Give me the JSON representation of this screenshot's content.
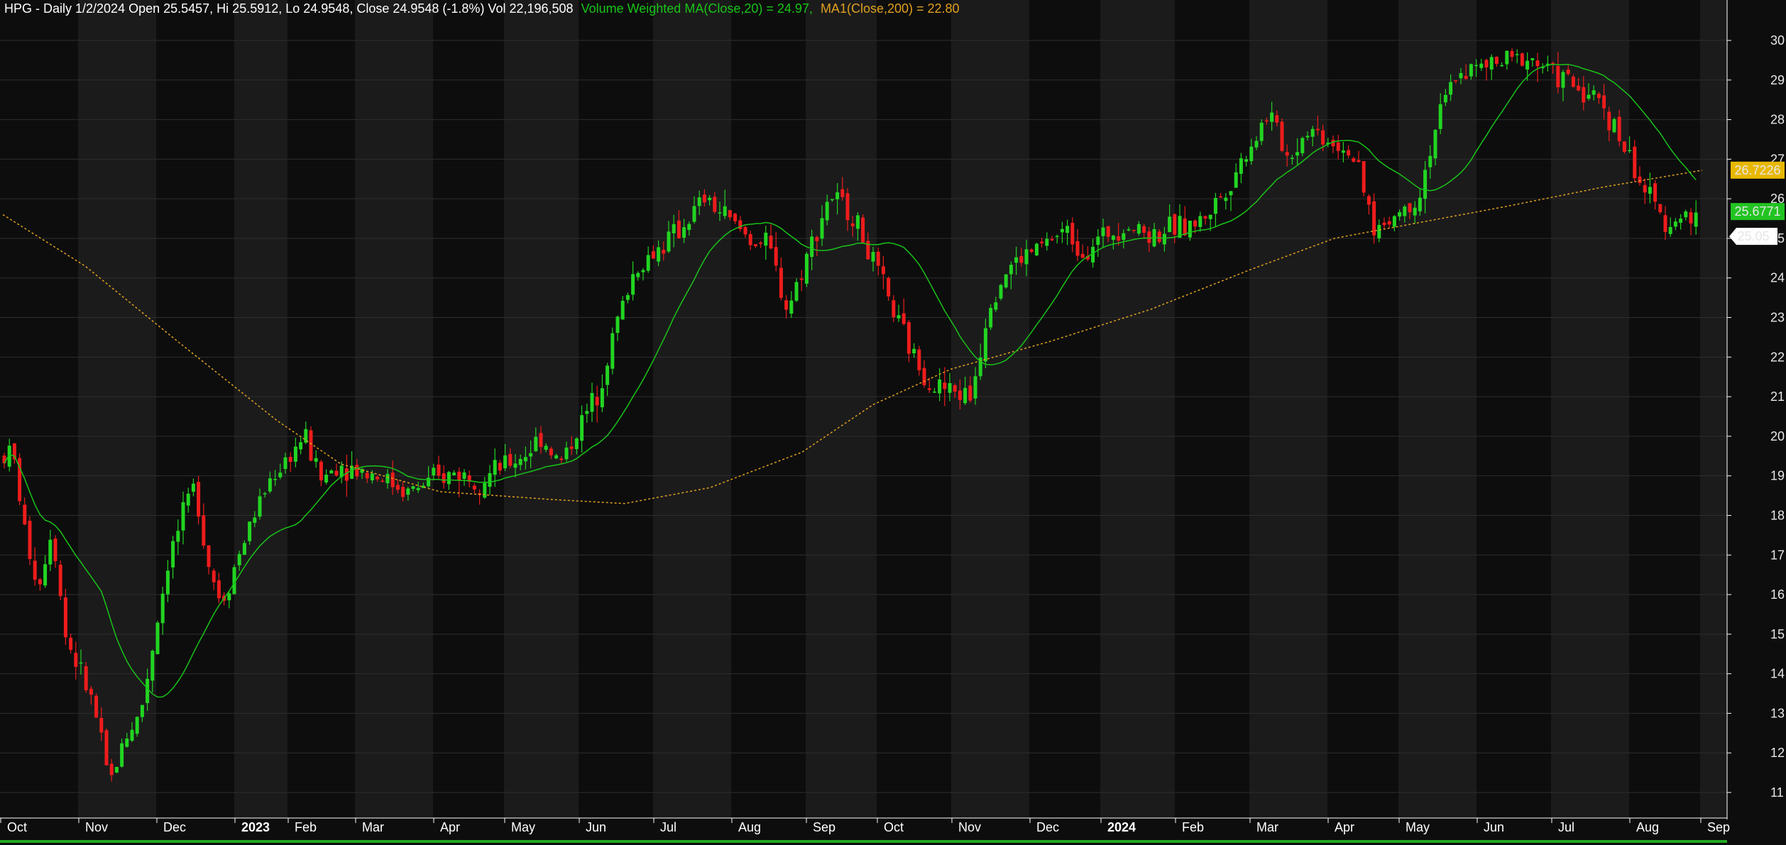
{
  "header": {
    "symbol_info": "HPG - Daily 1/2/2024 Open 25.5457, Hi 25.5912, Lo 24.9548, Close 24.9548 (-1.8%) Vol 22,196,508",
    "vwma_label": "Volume Weighted MA(Close,20) = 24.97,",
    "ma_label": "MA1(Close,200) = 22.80"
  },
  "colors": {
    "background": "#0d0d0d",
    "band_alt": "#1b1b1b",
    "grid": "#2e2e2e",
    "up": "#22d422",
    "down": "#ee1c1c",
    "vwma": "#19c419",
    "ma200": "#e0a020",
    "text": "#ffffff"
  },
  "chart_data": {
    "type": "candlestick",
    "title": "HPG - Daily",
    "x_labels": [
      "Oct",
      "Nov",
      "Dec",
      "2023",
      "Feb",
      "Mar",
      "Apr",
      "May",
      "Jun",
      "Jul",
      "Aug",
      "Sep",
      "Oct",
      "Nov",
      "Dec",
      "2024",
      "Feb",
      "Mar",
      "Apr",
      "May",
      "Jun",
      "Jul",
      "Aug",
      "Sep"
    ],
    "y_ticks": [
      11,
      12,
      13,
      14,
      15,
      16,
      17,
      18,
      19,
      20,
      21,
      22,
      23,
      24,
      25,
      26,
      27,
      28,
      29,
      30
    ],
    "ylim": [
      10.6,
      30.3
    ],
    "grid": true,
    "price_anchors": [
      [
        "Oct",
        19.6
      ],
      [
        "Oct",
        17.4
      ],
      [
        "Oct",
        16.2
      ],
      [
        "Oct",
        17.8
      ],
      [
        "Oct",
        15.0
      ],
      [
        "Nov",
        13.2
      ],
      [
        "Nov",
        11.2
      ],
      [
        "Nov",
        12.4
      ],
      [
        "Nov",
        13.0
      ],
      [
        "Dec",
        17.0
      ],
      [
        "Dec",
        17.9
      ],
      [
        "Dec",
        18.8
      ],
      [
        "Dec",
        16.8
      ],
      [
        "Dec",
        15.8
      ],
      [
        "2023",
        17.9
      ],
      [
        "2023",
        18.9
      ],
      [
        "Feb",
        20.0
      ],
      [
        "Feb",
        18.9
      ],
      [
        "Feb",
        19.3
      ],
      [
        "Mar",
        19.0
      ],
      [
        "Mar",
        18.6
      ],
      [
        "Apr",
        19.1
      ],
      [
        "Apr",
        18.9
      ],
      [
        "May",
        19.5
      ],
      [
        "May",
        20.0
      ],
      [
        "May",
        19.3
      ],
      [
        "Jun",
        21.1
      ],
      [
        "Jun",
        22.8
      ],
      [
        "Jun",
        24.2
      ],
      [
        "Jul",
        25.2
      ],
      [
        "Jul",
        26.0
      ],
      [
        "Aug",
        25.0
      ],
      [
        "Aug",
        24.8
      ],
      [
        "Aug",
        23.2
      ],
      [
        "Sep",
        26.1
      ],
      [
        "Sep",
        25.6
      ],
      [
        "Oct",
        23.0
      ],
      [
        "Oct",
        22.0
      ],
      [
        "Oct",
        21.3
      ],
      [
        "Nov",
        21.0
      ],
      [
        "Nov",
        23.5
      ],
      [
        "Nov",
        24.3
      ],
      [
        "Dec",
        24.9
      ],
      [
        "Dec",
        25.2
      ],
      [
        "Dec",
        24.7
      ],
      [
        "2024",
        25.4
      ],
      [
        "2024",
        25.1
      ],
      [
        "Feb",
        25.4
      ],
      [
        "Feb",
        26.2
      ],
      [
        "Mar",
        28.2
      ],
      [
        "Mar",
        27.0
      ],
      [
        "Mar",
        27.8
      ],
      [
        "Apr",
        27.2
      ],
      [
        "Apr",
        25.2
      ],
      [
        "May",
        26.0
      ],
      [
        "May",
        28.0
      ],
      [
        "May",
        29.2
      ],
      [
        "Jun",
        29.4
      ],
      [
        "Jun",
        29.6
      ],
      [
        "Jul",
        28.8
      ],
      [
        "Jul",
        28.4
      ],
      [
        "Aug",
        26.1
      ],
      [
        "Aug",
        25.4
      ],
      [
        "Aug",
        25.6
      ],
      [
        "Sep",
        25.05
      ]
    ],
    "series": [
      {
        "name": "Volume Weighted MA(Close,20)",
        "last": 25.6771
      },
      {
        "name": "MA1(Close,200)",
        "last": 26.7226
      }
    ],
    "last_price": 25.05,
    "price_tags": [
      "26.7226",
      "25.6771",
      "25.05"
    ]
  }
}
